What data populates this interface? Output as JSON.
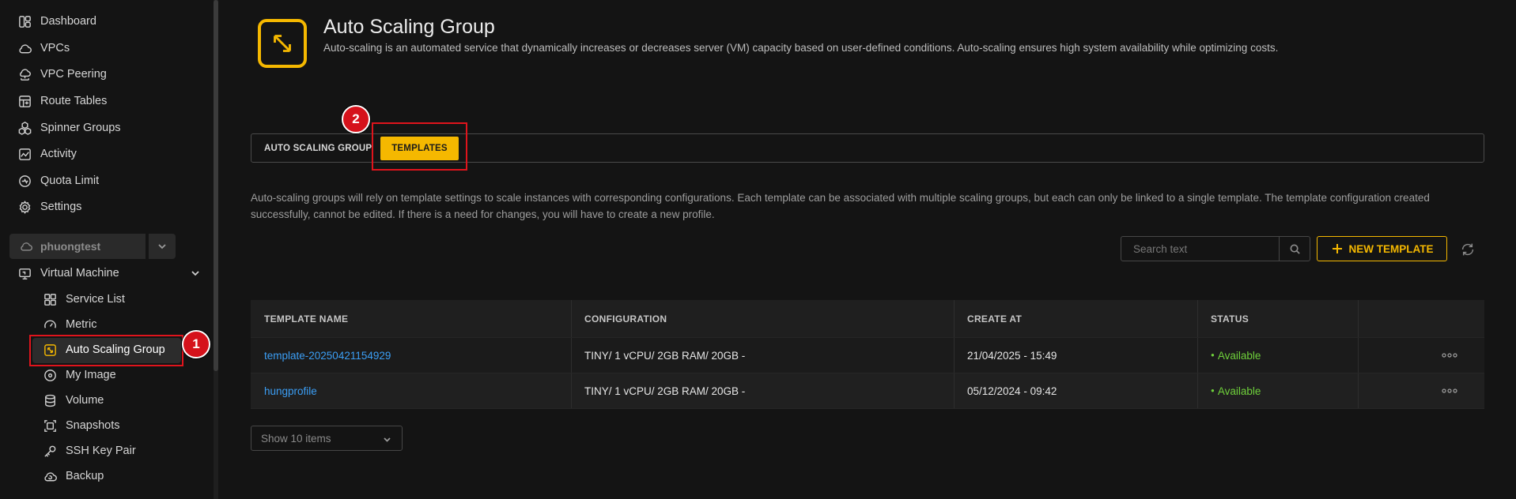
{
  "sidebar": {
    "items": [
      {
        "label": "Dashboard",
        "icon": "dashboard-icon"
      },
      {
        "label": "VPCs",
        "icon": "cloud-icon"
      },
      {
        "label": "VPC Peering",
        "icon": "cloud-network-icon"
      },
      {
        "label": "Route Tables",
        "icon": "route-table-icon"
      },
      {
        "label": "Spinner Groups",
        "icon": "hexagons-icon"
      },
      {
        "label": "Activity",
        "icon": "activity-icon"
      },
      {
        "label": "Quota Limit",
        "icon": "quota-icon"
      },
      {
        "label": "Settings",
        "icon": "gear-icon"
      }
    ],
    "project": {
      "label": "phuongtest",
      "icon": "cloud-icon"
    },
    "group": {
      "label": "Virtual Machine",
      "icon": "monitor-icon"
    },
    "sub_items": [
      {
        "label": "Service List",
        "icon": "grid-icon"
      },
      {
        "label": "Metric",
        "icon": "gauge-icon"
      },
      {
        "label": "Auto Scaling Group",
        "icon": "resize-icon",
        "active": true
      },
      {
        "label": "My Image",
        "icon": "disc-icon"
      },
      {
        "label": "Volume",
        "icon": "database-icon"
      },
      {
        "label": "Snapshots",
        "icon": "snapshot-icon"
      },
      {
        "label": "SSH Key Pair",
        "icon": "key-icon"
      },
      {
        "label": "Backup",
        "icon": "cloud-backup-icon"
      }
    ]
  },
  "annotations": {
    "step1": "1",
    "step2": "2"
  },
  "header": {
    "title": "Auto Scaling Group",
    "description": "Auto-scaling is an automated service that dynamically increases or decreases server (VM) capacity based on user-defined conditions. Auto-scaling ensures high system availability while optimizing costs."
  },
  "tabs": {
    "auto_scaling_group": "AUTO SCALING GROUP",
    "templates": "TEMPLATES",
    "active": "templates"
  },
  "info_text": "Auto-scaling groups will rely on template settings to scale instances with corresponding configurations. Each template can be associated with multiple scaling groups, but each can only be linked to a single template. The template configuration created successfully, cannot be edited. If there is a need for changes, you will have to create a new profile.",
  "toolbar": {
    "search_placeholder": "Search text",
    "new_template_label": "NEW TEMPLATE"
  },
  "table": {
    "headers": [
      "TEMPLATE NAME",
      "CONFIGURATION",
      "CREATE AT",
      "STATUS"
    ],
    "rows": [
      {
        "name": "template-20250421154929",
        "configuration": "TINY/ 1 vCPU/ 2GB RAM/ 20GB -",
        "created_at": "21/04/2025 - 15:49",
        "status": "Available"
      },
      {
        "name": "hungprofile",
        "configuration": "TINY/ 1 vCPU/ 2GB RAM/ 20GB -",
        "created_at": "05/12/2024 - 09:42",
        "status": "Available"
      }
    ]
  },
  "pagination": {
    "page_size_label": "Show 10 items"
  },
  "colors": {
    "accent": "#f5b800",
    "link": "#3b9ef5",
    "status_available": "#6fd13b",
    "annotation": "#d5121b"
  }
}
